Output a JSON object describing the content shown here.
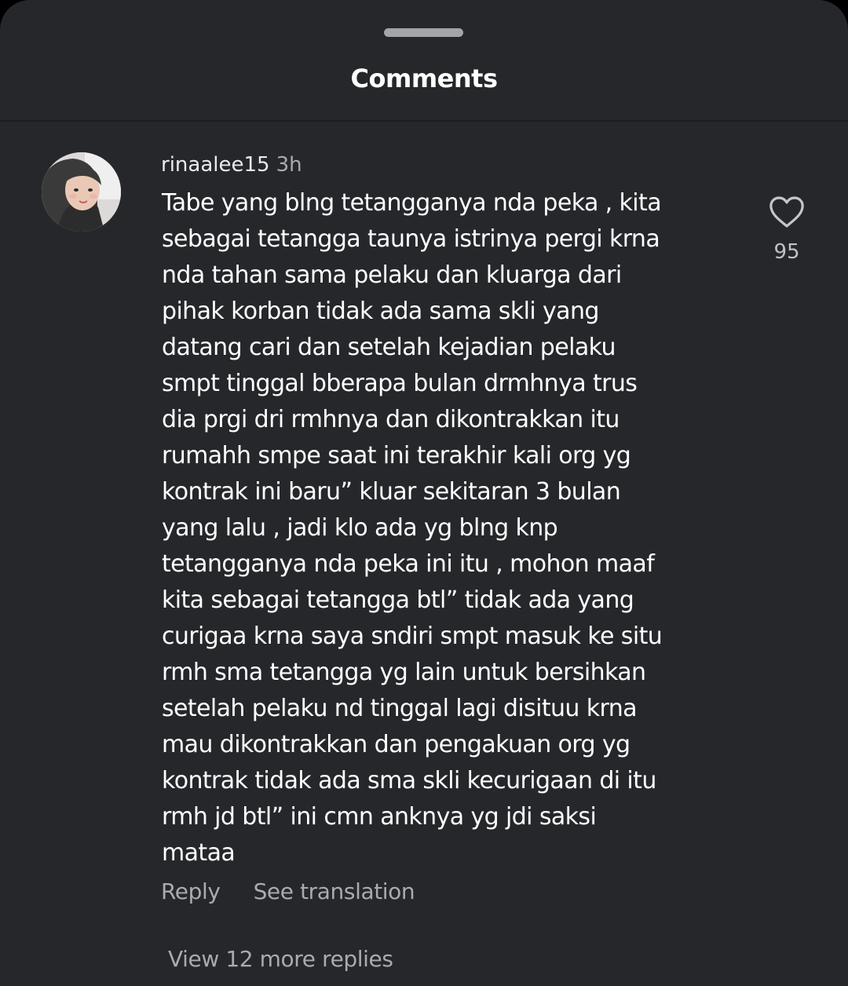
{
  "sheet": {
    "title": "Comments"
  },
  "comment": {
    "username": "rinaalee15",
    "time": "3h",
    "text": "Tabe yang blng tetangganya nda peka , kita\nsebagai tetangga taunya istrinya pergi krna\nnda tahan sama pelaku dan kluarga dari\npihak korban tidak ada sama skli yang\ndatang cari dan setelah kejadian pelaku\nsmpt tinggal bberapa bulan drmhnya trus\ndia prgi dri rmhnya dan dikontrakkan itu\nrumahh smpe saat ini terakhir kali org yg\nkontrak ini baru” kluar sekitaran 3 bulan\nyang lalu , jadi klo ada yg blng knp\ntetangganya nda peka ini itu , mohon maaf\nkita sebagai tetangga btl” tidak ada yang\ncurigaa krna saya sndiri smpt masuk ke situ\nrmh sma tetangga yg lain untuk bersihkan\nsetelah pelaku nd tinggal lagi disituu krna\nmau dikontrakkan dan pengakuan org yg\nkontrak tidak ada sma skli kecurigaan di itu\nrmh jd btl” ini cmn anknya yg jdi saksi\nmataa",
    "likes": "95",
    "like_icon": "heart-outline-icon",
    "reply_label": "Reply",
    "translate_label": "See translation",
    "more_replies_label": "View 12 more replies"
  },
  "colors": {
    "background": "#25272b",
    "text_primary": "#ffffff",
    "text_secondary": "#a9abae"
  }
}
